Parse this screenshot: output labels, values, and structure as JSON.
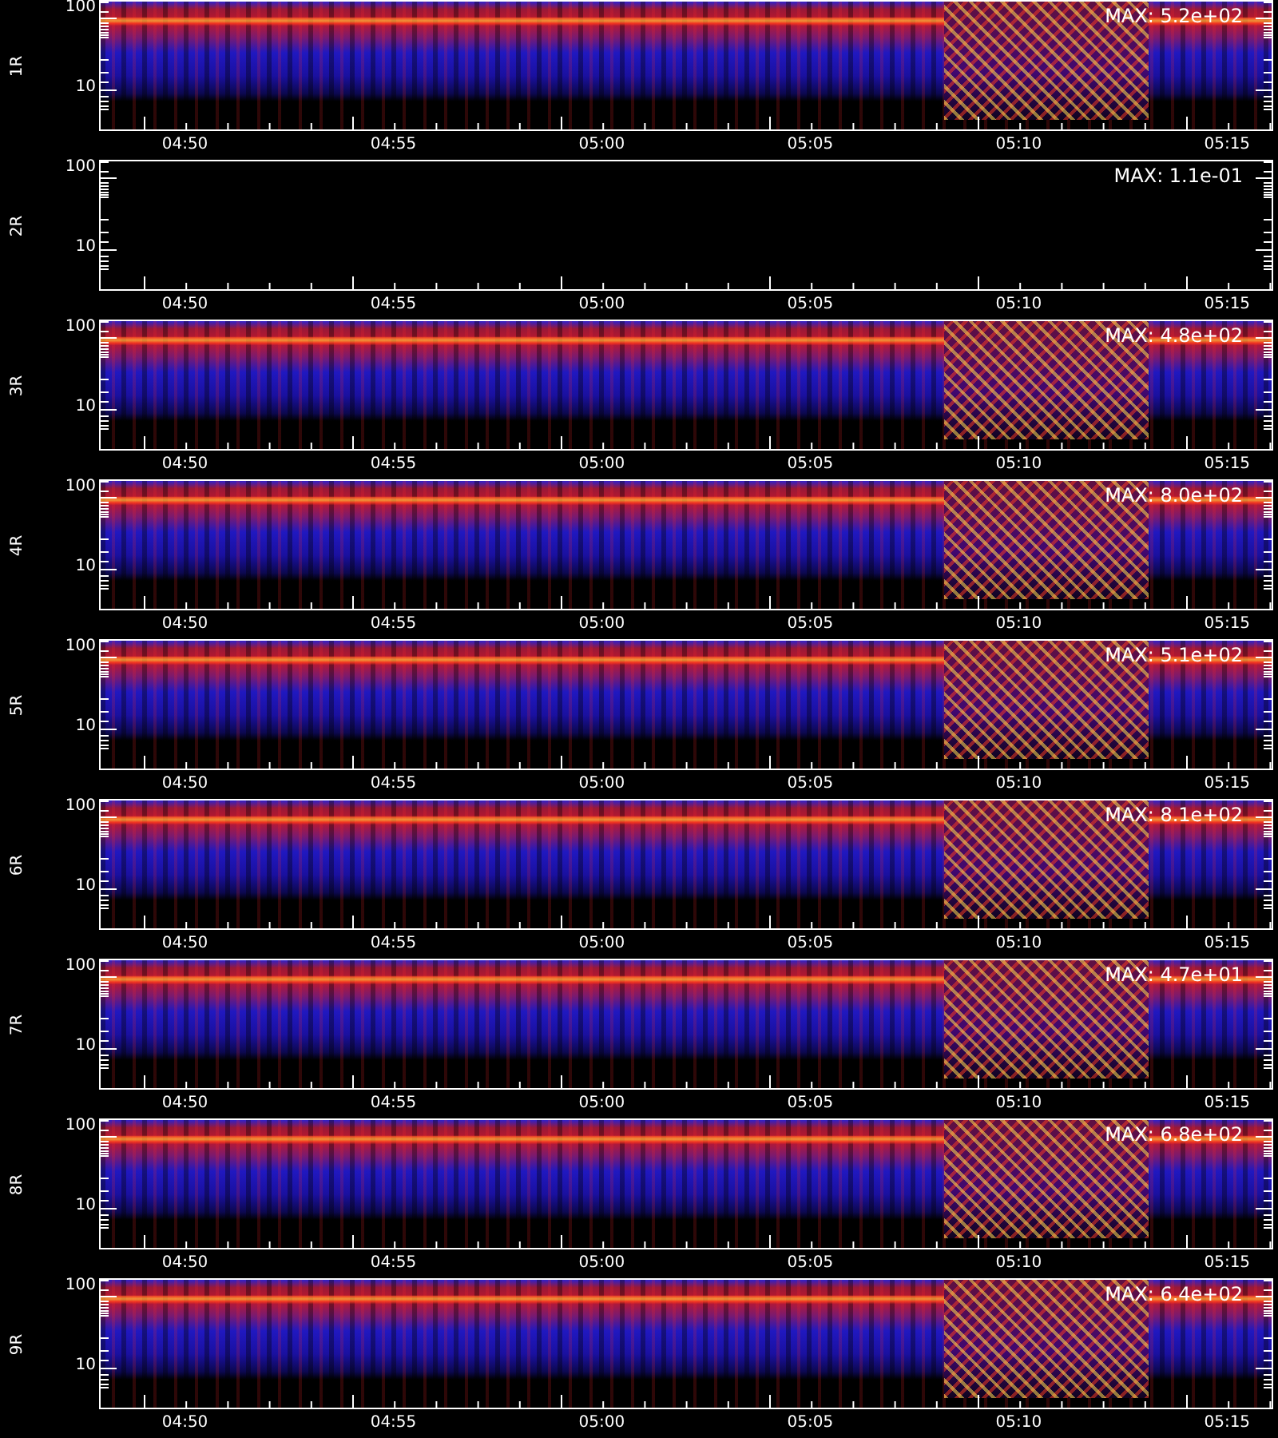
{
  "panels": [
    {
      "label": "1R",
      "max": "MAX: 5.2e+02",
      "kind": "spectrogram",
      "y_ticks": [
        "100",
        "10"
      ],
      "x_ticks": [
        "04:50",
        "04:55",
        "05:00",
        "05:05",
        "05:10",
        "05:15"
      ]
    },
    {
      "label": "2R",
      "max": "MAX: 1.1e-01",
      "kind": "empty",
      "y_ticks": [
        "100",
        "10"
      ],
      "x_ticks": [
        "04:50",
        "04:55",
        "05:00",
        "05:05",
        "05:10",
        "05:15"
      ]
    },
    {
      "label": "3R",
      "max": "MAX: 4.8e+02",
      "kind": "spectrogram",
      "y_ticks": [
        "100",
        "10"
      ],
      "x_ticks": [
        "04:50",
        "04:55",
        "05:00",
        "05:05",
        "05:10",
        "05:15"
      ]
    },
    {
      "label": "4R",
      "max": "MAX: 8.0e+02",
      "kind": "spectrogram",
      "y_ticks": [
        "100",
        "10"
      ],
      "x_ticks": [
        "04:50",
        "04:55",
        "05:00",
        "05:05",
        "05:10",
        "05:15"
      ]
    },
    {
      "label": "5R",
      "max": "MAX: 5.1e+02",
      "kind": "spectrogram",
      "y_ticks": [
        "100",
        "10"
      ],
      "x_ticks": [
        "04:50",
        "04:55",
        "05:00",
        "05:05",
        "05:10",
        "05:15"
      ]
    },
    {
      "label": "6R",
      "max": "MAX: 8.1e+02",
      "kind": "spectrogram",
      "y_ticks": [
        "100",
        "10"
      ],
      "x_ticks": [
        "04:50",
        "04:55",
        "05:00",
        "05:05",
        "05:10",
        "05:15"
      ]
    },
    {
      "label": "7R",
      "max": "MAX: 4.7e+01",
      "kind": "spectrogram",
      "y_ticks": [
        "100",
        "10"
      ],
      "x_ticks": [
        "04:50",
        "04:55",
        "05:00",
        "05:05",
        "05:10",
        "05:15"
      ]
    },
    {
      "label": "8R",
      "max": "MAX: 6.8e+02",
      "kind": "spectrogram",
      "y_ticks": [
        "100",
        "10"
      ],
      "x_ticks": [
        "04:50",
        "04:55",
        "05:00",
        "05:05",
        "05:10",
        "05:15"
      ]
    },
    {
      "label": "9R",
      "max": "MAX: 6.4e+02",
      "kind": "spectrogram",
      "y_ticks": [
        "100",
        "10"
      ],
      "x_ticks": [
        "04:50",
        "04:55",
        "05:00",
        "05:05",
        "05:10",
        "05:15"
      ]
    }
  ]
}
